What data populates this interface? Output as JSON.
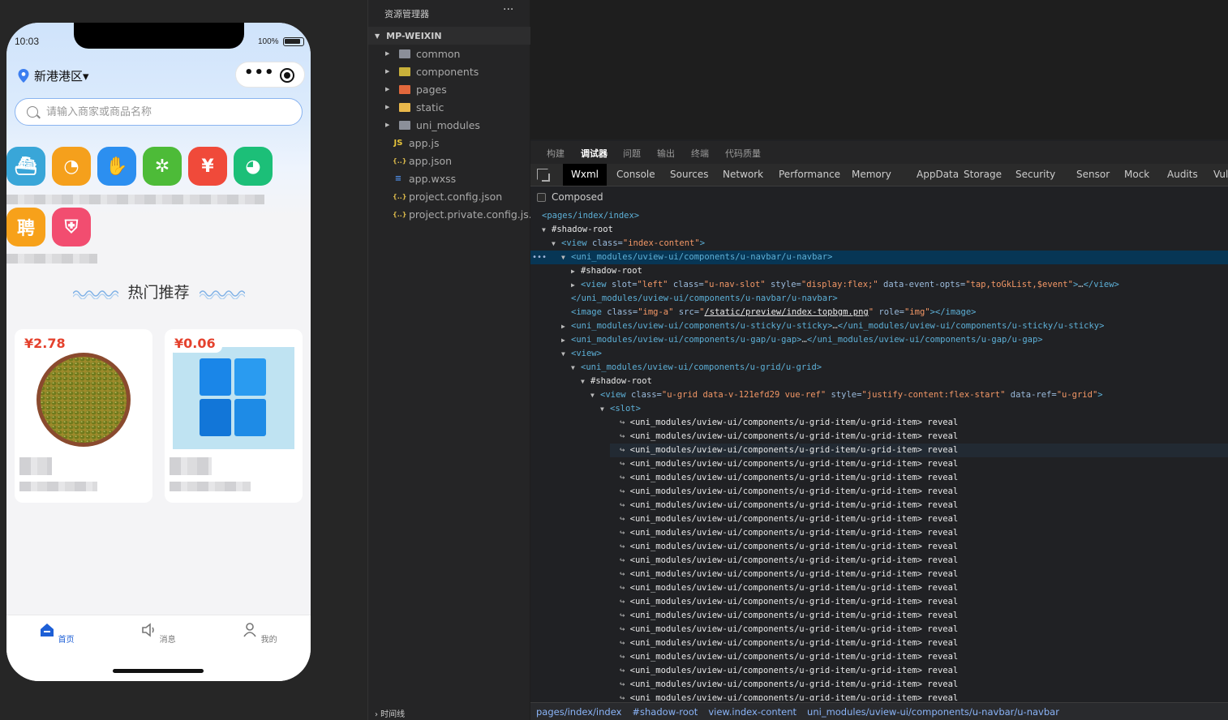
{
  "phone": {
    "status_time": "10:03",
    "battery_text": "100%",
    "location": "新港港区▾",
    "search_placeholder": "请输入商家或商品名称",
    "hot_title": "热门推荐",
    "apps_row1": [
      {
        "icon": "ship-icon",
        "color": "#39a6d8"
      },
      {
        "icon": "orange-icon",
        "color": "#f5a01c"
      },
      {
        "icon": "hand-icon",
        "color": "#2c8ff0"
      },
      {
        "icon": "wheel-icon",
        "color": "#4dbb38"
      },
      {
        "icon": "wallet-icon",
        "color": "#f04a3a"
      },
      {
        "icon": "pacman-icon",
        "color": "#1cbf78"
      }
    ],
    "apps_row2": [
      {
        "icon": "hire-icon",
        "label": "聘",
        "color": "#f7a11a"
      },
      {
        "icon": "shield-icon",
        "color": "#f24d70"
      }
    ],
    "products": [
      {
        "price": "¥2.78",
        "image": "mung-beans-image"
      },
      {
        "price": "¥0.06",
        "image": "windows-logo-image"
      }
    ],
    "tabs": [
      {
        "label": "首页",
        "icon": "home-icon",
        "active": true
      },
      {
        "label": "消息",
        "icon": "speaker-icon",
        "active": false
      },
      {
        "label": "我的",
        "icon": "user-icon",
        "active": false
      }
    ]
  },
  "explorer": {
    "title": "资源管理器",
    "more": "···",
    "section": "MP-WEIXIN",
    "items": [
      {
        "name": "common",
        "type": "folder",
        "color": "#8b8f99"
      },
      {
        "name": "components",
        "type": "folder",
        "color": "#c9b13a"
      },
      {
        "name": "pages",
        "type": "folder",
        "color": "#e2683c"
      },
      {
        "name": "static",
        "type": "folder",
        "color": "#e9b84b"
      },
      {
        "name": "uni_modules",
        "type": "folder",
        "color": "#8b8f99"
      },
      {
        "name": "app.js",
        "type": "file",
        "glyph": "JS",
        "color": "#e5c33b"
      },
      {
        "name": "app.json",
        "type": "file",
        "glyph": "{..}",
        "color": "#d8b74a"
      },
      {
        "name": "app.wxss",
        "type": "file",
        "glyph": "≡",
        "color": "#4e8ee8"
      },
      {
        "name": "project.config.json",
        "type": "file",
        "glyph": "{..}",
        "color": "#d8b74a"
      },
      {
        "name": "project.private.config.js...",
        "type": "file",
        "glyph": "{..}",
        "color": "#d8b74a"
      }
    ],
    "footer": "› 时间线"
  },
  "debugger": {
    "top_tabs": [
      "构建",
      "调试器",
      "问题",
      "输出",
      "终端",
      "代码质量"
    ],
    "active_top_tab": "调试器",
    "dev_tabs": [
      "Wxml",
      "Console",
      "Sources",
      "Network",
      "Performance",
      "Memory",
      "AppData",
      "Storage",
      "Security",
      "Sensor",
      "Mock",
      "Audits",
      "Vul"
    ],
    "active_dev_tab": "Wxml",
    "composed_label": "Composed",
    "grid_item_text": "<uni_modules/uview-ui/components/u-grid-item/u-grid-item>",
    "reveal": "reveal",
    "grid_item_count": 22,
    "breadcrumb": [
      "pages/index/index",
      "#shadow-root",
      "view.index-content",
      "uni_modules/uview-ui/components/u-navbar/u-navbar"
    ]
  }
}
